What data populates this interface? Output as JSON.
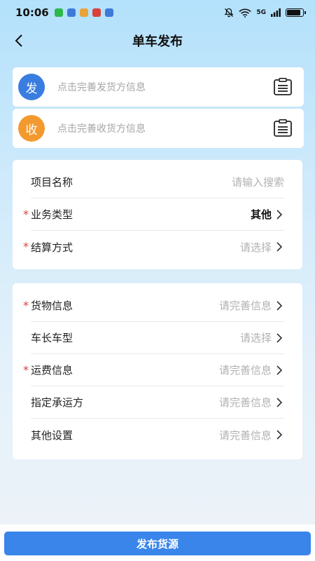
{
  "status_bar": {
    "time": "10:06",
    "network": "5G",
    "notif_colors": [
      "#2db84c",
      "#3d7bd9",
      "#e8a33a",
      "#d9403a",
      "#3d7bd9"
    ],
    "icons": [
      "mute-bell-icon",
      "wifi-icon",
      "signal-icon",
      "battery-icon"
    ]
  },
  "nav": {
    "title": "单车发布",
    "back_icon": "chevron-left-icon"
  },
  "sender": {
    "badge": "发",
    "color": "#3a7de0",
    "prompt": "点击完善发货方信息",
    "icon": "clipboard-icon"
  },
  "receiver": {
    "badge": "收",
    "color": "#f39a2f",
    "prompt": "点击完善收货方信息",
    "icon": "clipboard-icon"
  },
  "section1": [
    {
      "label": "项目名称",
      "required": "",
      "value": "请输入搜索",
      "filled": false,
      "chevron": false
    },
    {
      "label": "业务类型",
      "required": "*",
      "value": "其他",
      "filled": true,
      "chevron": true
    },
    {
      "label": "结算方式",
      "required": "*",
      "value": "请选择",
      "filled": false,
      "chevron": true
    }
  ],
  "section2": [
    {
      "label": "货物信息",
      "required": "*",
      "value": "请完善信息",
      "filled": false,
      "chevron": true
    },
    {
      "label": "车长车型",
      "required": "",
      "value": "请选择",
      "filled": false,
      "chevron": true
    },
    {
      "label": "运费信息",
      "required": "*",
      "value": "请完善信息",
      "filled": false,
      "chevron": true
    },
    {
      "label": "指定承运方",
      "required": "",
      "value": "请完善信息",
      "filled": false,
      "chevron": true
    },
    {
      "label": "其他设置",
      "required": "",
      "value": "请完善信息",
      "filled": false,
      "chevron": true
    }
  ],
  "submit": {
    "label": "发布货源",
    "color": "#3a85ea"
  }
}
